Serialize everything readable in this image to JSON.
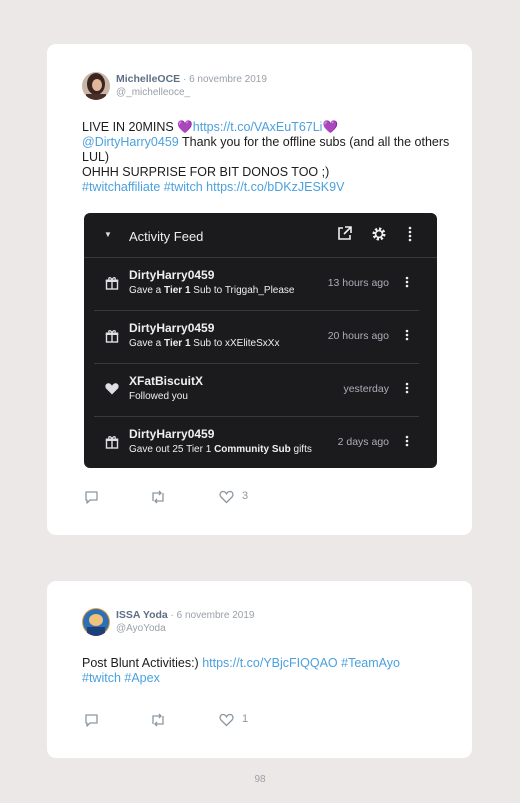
{
  "tweets": [
    {
      "author": "MichelleOCE",
      "date": " · 6 novembre 2019",
      "handle": "@_michelleoce_",
      "text": {
        "l1a": "LIVE IN 20MINS ",
        "l1heart": "💜",
        "l1link": "https://t.co/VAxEuT67Li",
        "l1heart2": "💜",
        "l2mention": "@DirtyHarry0459",
        "l2rest": " Thank you for the offline subs (and all the others LUL)",
        "l3": "OHHH SURPRISE FOR BIT DONOS TOO ;)",
        "l4tag1": "#twitchaffiliate",
        "l4tag2": "#twitch",
        "l4link": "https://t.co/bDKzJESK9V"
      },
      "likes": "3",
      "media": {
        "title": "Activity Feed",
        "rows": [
          {
            "user": "DirtyHarry0459",
            "pre": "Gave a ",
            "bold": "Tier 1",
            "post": " Sub to Triggah_Please",
            "time": "13 hours ago",
            "icon": "gift-icon"
          },
          {
            "user": "DirtyHarry0459",
            "pre": "Gave a ",
            "bold": "Tier 1",
            "post": " Sub to xXEliteSxXx",
            "time": "20 hours ago",
            "icon": "gift-icon"
          },
          {
            "user": "XFatBiscuitX",
            "pre": "Followed you",
            "bold": "",
            "post": "",
            "time": "yesterday",
            "icon": "heart-icon"
          },
          {
            "user": "DirtyHarry0459",
            "pre": "Gave out 25 Tier 1 ",
            "bold": "Community Sub",
            "post": " gifts",
            "time": "2 days ago",
            "icon": "gift-icon"
          }
        ]
      }
    },
    {
      "author": "ISSA Yoda",
      "date": " · 6 novembre 2019",
      "handle": "@AyoYoda",
      "text": {
        "l1a": "Post Blunt Activities:) ",
        "l1link": "https://t.co/YBjcFIQQAO",
        "l1tag1": "#TeamAyo",
        "l2tag1": "#twitch",
        "l2tag2": "#Apex"
      },
      "likes": "1"
    }
  ],
  "page_number": "98",
  "colors": {
    "link": "#4ba1df",
    "heart": "#9b6fd1",
    "feed_bg": "#1b1b1e"
  }
}
